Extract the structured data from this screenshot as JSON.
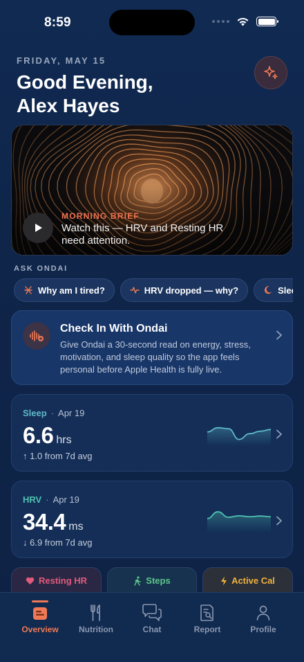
{
  "status_bar": {
    "time": "8:59"
  },
  "header": {
    "date": "FRIDAY, MAY 15",
    "greeting_line1": "Good Evening,",
    "greeting_line2": "Alex Hayes",
    "action_icon": "sparkle-icon"
  },
  "hero": {
    "tag": "MORNING BRIEF",
    "text": "Watch this — HRV and Resting HR need attention.",
    "play_icon": "play-icon",
    "accent": "#f0714e"
  },
  "ask": {
    "label": "ASK ONDAI",
    "chips": [
      {
        "label": "Why am I tired?",
        "icon": "tired-icon"
      },
      {
        "label": "HRV dropped — why?",
        "icon": "pulse-icon"
      },
      {
        "label": "Sleep isn't",
        "icon": "moon-icon"
      }
    ]
  },
  "checkin": {
    "title": "Check In With Ondai",
    "body": "Give Ondai a 30-second read on energy, stress, motivation, and sleep quality so the app feels personal before Apple Health is fully live.",
    "icon": "voice-wave-icon"
  },
  "metrics": [
    {
      "name": "Sleep",
      "date": "Apr 19",
      "value": "6.6",
      "unit": "hrs",
      "delta": "↑ 1.0 from 7d avg",
      "color": "#5fb8c8",
      "trend": [
        0.45,
        0.62,
        0.58,
        0.15,
        0.38,
        0.48,
        0.55
      ]
    },
    {
      "name": "HRV",
      "date": "Apr 19",
      "value": "34.4",
      "unit": "ms",
      "delta": "↓ 6.9 from 7d avg",
      "color": "#4fc2b0",
      "trend": [
        0.45,
        0.72,
        0.5,
        0.56,
        0.52,
        0.55,
        0.52
      ]
    }
  ],
  "mini_cards": [
    {
      "label": "Resting HR",
      "icon": "heart-icon",
      "color": "#e25b7c"
    },
    {
      "label": "Steps",
      "icon": "walk-icon",
      "color": "#5ec78a"
    },
    {
      "label": "Active Cal",
      "icon": "bolt-icon",
      "color": "#f0b23c"
    }
  ],
  "tabs": [
    {
      "label": "Overview",
      "icon": "overview-icon",
      "active": true
    },
    {
      "label": "Nutrition",
      "icon": "fork-knife-icon",
      "active": false
    },
    {
      "label": "Chat",
      "icon": "chat-icon",
      "active": false
    },
    {
      "label": "Report",
      "icon": "report-icon",
      "active": false
    },
    {
      "label": "Profile",
      "icon": "profile-icon",
      "active": false
    }
  ]
}
